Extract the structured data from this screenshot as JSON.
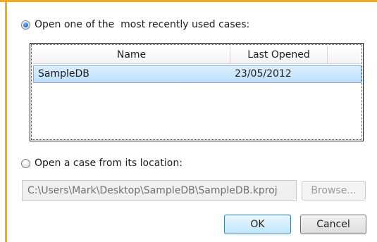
{
  "recent_option": {
    "label": "Open one of the  most recently used cases:",
    "selected": true
  },
  "recent_list": {
    "columns": [
      "Name",
      "Last Opened"
    ],
    "rows": [
      {
        "name": "SampleDB",
        "last_opened": "23/05/2012",
        "selected": true
      }
    ]
  },
  "location_option": {
    "label": "Open a case from its location:",
    "selected": false
  },
  "path_field": {
    "value": "C:\\Users\\Mark\\Desktop\\SampleDB\\SampleDB.kproj"
  },
  "buttons": {
    "browse": "Browse...",
    "ok": "OK",
    "cancel": "Cancel"
  },
  "colors": {
    "accent_border": "#f5a623",
    "selection": "#bfe0fa",
    "radio_selected": "#2a6fd6"
  }
}
